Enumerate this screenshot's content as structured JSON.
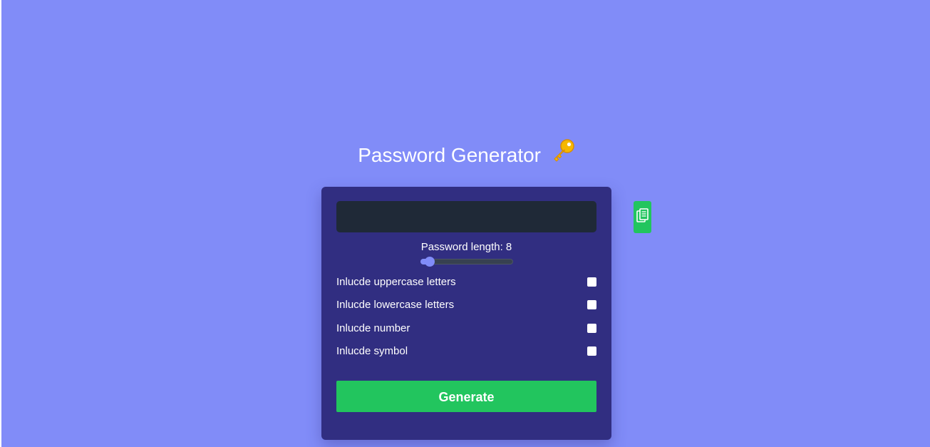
{
  "header": {
    "title": "Password Generator",
    "title_icon": "key-icon"
  },
  "generator": {
    "result_value": "",
    "length_label": "Password length: 8",
    "length": {
      "value": 8,
      "slider_fraction": 0.1
    },
    "options": [
      {
        "label": "Inlucde uppercase letters",
        "checked": true
      },
      {
        "label": "Inlucde lowercase letters",
        "checked": true
      },
      {
        "label": "Inlucde number",
        "checked": true
      },
      {
        "label": "Inlucde symbol",
        "checked": true
      }
    ],
    "generate_label": "Generate",
    "clipboard_icon": "clipboard-icon"
  },
  "colors": {
    "background": "#818cf8",
    "card": "#312e81",
    "result_field": "#1f2937",
    "accent_green": "#22c55e",
    "slider_accent": "#818cf8"
  }
}
